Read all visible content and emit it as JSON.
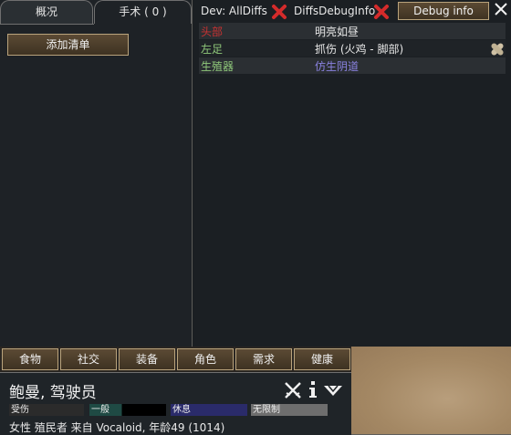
{
  "tabs": {
    "overview": "概况",
    "operations": "手术 ( 0 )"
  },
  "add_bill_label": "添加清单",
  "dev": {
    "all_diffs": "Dev: AllDiffs",
    "diffs_debug_info": "DiffsDebugInfo",
    "debug_info_button": "Debug info"
  },
  "health_rows": [
    {
      "part": "头部",
      "condition": "明亮如昼",
      "part_color": "#c83232",
      "condition_color": "#e6e6e6"
    },
    {
      "part": "左足",
      "condition": "抓伤 (火鸡 - 脚部)",
      "part_color": "#8fc87a",
      "condition_color": "#e6e6e6"
    },
    {
      "part": "生殖器",
      "condition": "仿生阴道",
      "part_color": "#8fc87a",
      "condition_color": "#8a82e0"
    }
  ],
  "bottom_tabs": [
    "食物",
    "社交",
    "装备",
    "角色",
    "需求",
    "健康"
  ],
  "pawn": {
    "name": "鲍曼, 驾驶员",
    "bars": {
      "mood": "受伤",
      "general": "一般",
      "rest": "休息",
      "unrestricted": "无限制"
    },
    "description": "女性 殖民者 来自 Vocaloid, 年龄49 (1014)"
  },
  "colors": {
    "accent_red": "#d42b2b",
    "button_border": "#b9a37c"
  }
}
